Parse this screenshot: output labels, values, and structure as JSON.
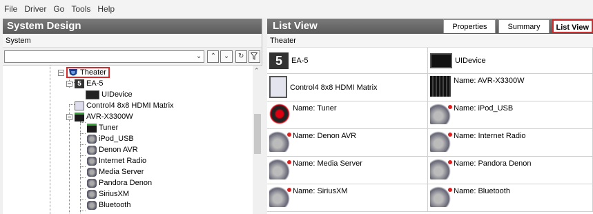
{
  "menu": [
    "File",
    "Driver",
    "Go",
    "Tools",
    "Help"
  ],
  "left": {
    "title": "System Design",
    "subtitle": "System",
    "tree": [
      {
        "label": "Theater",
        "icon": "theater-icon",
        "highlighted": true
      },
      {
        "label": "EA-5",
        "icon": "ea5-icon"
      },
      {
        "label": "UIDevice",
        "icon": "uidevice-icon"
      },
      {
        "label": "Control4 8x8 HDMI Matrix",
        "icon": "matrix-icon"
      },
      {
        "label": "AVR-X3300W",
        "icon": "receiver-icon"
      },
      {
        "label": "Tuner",
        "icon": "tuner-icon"
      },
      {
        "label": "iPod_USB",
        "icon": "media-icon"
      },
      {
        "label": "Denon AVR",
        "icon": "media-icon"
      },
      {
        "label": "Internet Radio",
        "icon": "media-icon"
      },
      {
        "label": "Media Server",
        "icon": "media-icon"
      },
      {
        "label": "Pandora Denon",
        "icon": "media-icon"
      },
      {
        "label": "SiriusXM",
        "icon": "media-icon"
      },
      {
        "label": "Bluetooth",
        "icon": "media-icon"
      }
    ]
  },
  "right": {
    "title": "List View",
    "subtitle": "Theater",
    "tabs": [
      {
        "label": "Properties",
        "active": false
      },
      {
        "label": "Summary",
        "active": false
      },
      {
        "label": "List View",
        "active": true
      }
    ],
    "cells": [
      {
        "label": "EA-5",
        "icon": "ea5-icon"
      },
      {
        "label": "UIDevice",
        "icon": "uidevice-icon"
      },
      {
        "label": "Control4 8x8 HDMI Matrix",
        "icon": "matrix-icon"
      },
      {
        "label": "Name:  AVR-X3300W",
        "icon": "receiver-icon"
      },
      {
        "label": "Name:  Tuner",
        "icon": "tuner-icon"
      },
      {
        "label": "Name:  iPod_USB",
        "icon": "media-icon"
      },
      {
        "label": "Name:  Denon AVR",
        "icon": "media-icon"
      },
      {
        "label": "Name:  Internet Radio",
        "icon": "media-icon"
      },
      {
        "label": "Name:  Media Server",
        "icon": "media-icon"
      },
      {
        "label": "Name:  Pandora Denon",
        "icon": "media-icon"
      },
      {
        "label": "Name:  SiriusXM",
        "icon": "media-icon"
      },
      {
        "label": "Name:  Bluetooth",
        "icon": "media-icon"
      }
    ]
  },
  "colors": {
    "highlight_border": "#d12b2b",
    "header_bg": "#6a6a6a"
  }
}
